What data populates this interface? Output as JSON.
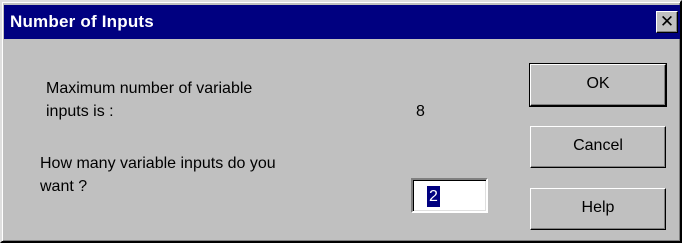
{
  "window": {
    "title": "Number of Inputs",
    "close_glyph": "✕"
  },
  "content": {
    "max_label_line1": "Maximum number of variable",
    "max_label_line2": "inputs is :",
    "max_value": "8",
    "how_many_line1": "How many variable inputs do you",
    "how_many_line2": "want ?",
    "input_value": "2"
  },
  "buttons": {
    "ok": "OK",
    "cancel": "Cancel",
    "help": "Help"
  },
  "colors": {
    "title_bar": "#000080",
    "dialog_face": "#c0c0c0",
    "selection": "#000080"
  },
  "icons": {
    "close": "close-icon"
  }
}
